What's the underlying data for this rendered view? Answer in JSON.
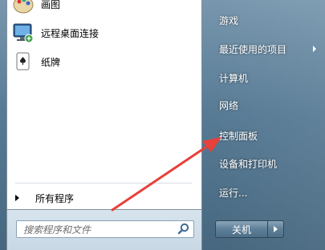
{
  "programs": [
    {
      "label": "画图",
      "icon": "paint-icon"
    },
    {
      "label": "远程桌面连接",
      "icon": "remote-desktop-icon"
    },
    {
      "label": "纸牌",
      "icon": "solitaire-icon"
    }
  ],
  "all_programs": "所有程序",
  "search": {
    "placeholder": "搜索程序和文件"
  },
  "right_items": [
    {
      "label": "游戏"
    },
    {
      "label": "最近使用的项目",
      "has_submenu": true
    },
    {
      "label": "计算机"
    },
    {
      "label": "网络"
    },
    {
      "label": "控制面板"
    },
    {
      "label": "设备和打印机"
    },
    {
      "label": "运行..."
    }
  ],
  "shutdown": {
    "label": "关机"
  },
  "annotation": {
    "arrow_color": "#e8403a"
  }
}
